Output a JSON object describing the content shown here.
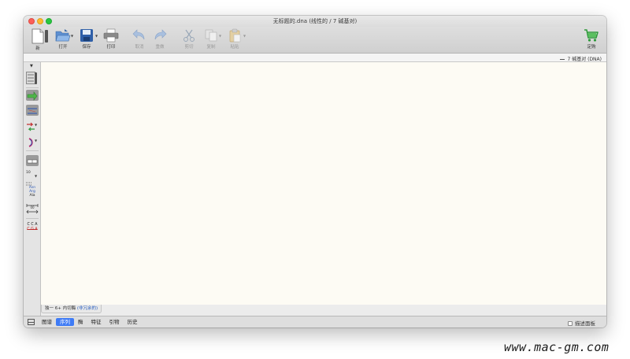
{
  "window": {
    "title": "无标题的.dna  (线性的 / 7 碱基对)"
  },
  "toolbar": {
    "new": "新",
    "open": "打开",
    "save": "保存",
    "print": "打印",
    "undo": "取消",
    "redo": "重做",
    "cut": "剪切",
    "copy": "复制",
    "paste": "粘贴",
    "order": "定购"
  },
  "info": {
    "summary": "7 碱基对  (DNA)"
  },
  "sidebar": {
    "tools": [
      "map-view-tool",
      "feature-arrow-tool",
      "strand-tool",
      "primer-tool",
      "bracket-tool",
      "selection-bar-tool",
      "numbering-tool",
      "translation-tool",
      "ruler-tool",
      "restriction-site-tool"
    ],
    "numbering_label": "10",
    "translation_label": [
      "Asn",
      "Arg",
      "Ala"
    ],
    "ruler_label": "00",
    "restriction_label": [
      "C C A",
      "C G A"
    ]
  },
  "enzyme_tab": {
    "label": "独一 6+ 内切酶",
    "state": "(非冗余的)"
  },
  "bottom": {
    "tabs": [
      {
        "label": "图谱",
        "active": false
      },
      {
        "label": "序列",
        "active": true
      },
      {
        "label": "酶",
        "active": false
      },
      {
        "label": "特征",
        "active": false
      },
      {
        "label": "引物",
        "active": false
      },
      {
        "label": "历史",
        "active": false
      }
    ],
    "description_panel": "描述面板",
    "description_checked": false
  },
  "watermark": "www.mac-gm.com",
  "colors": {
    "active_tab": "#3e7bf6",
    "canvas": "#fdfbf4",
    "order_cart": "#2e9a3a"
  }
}
